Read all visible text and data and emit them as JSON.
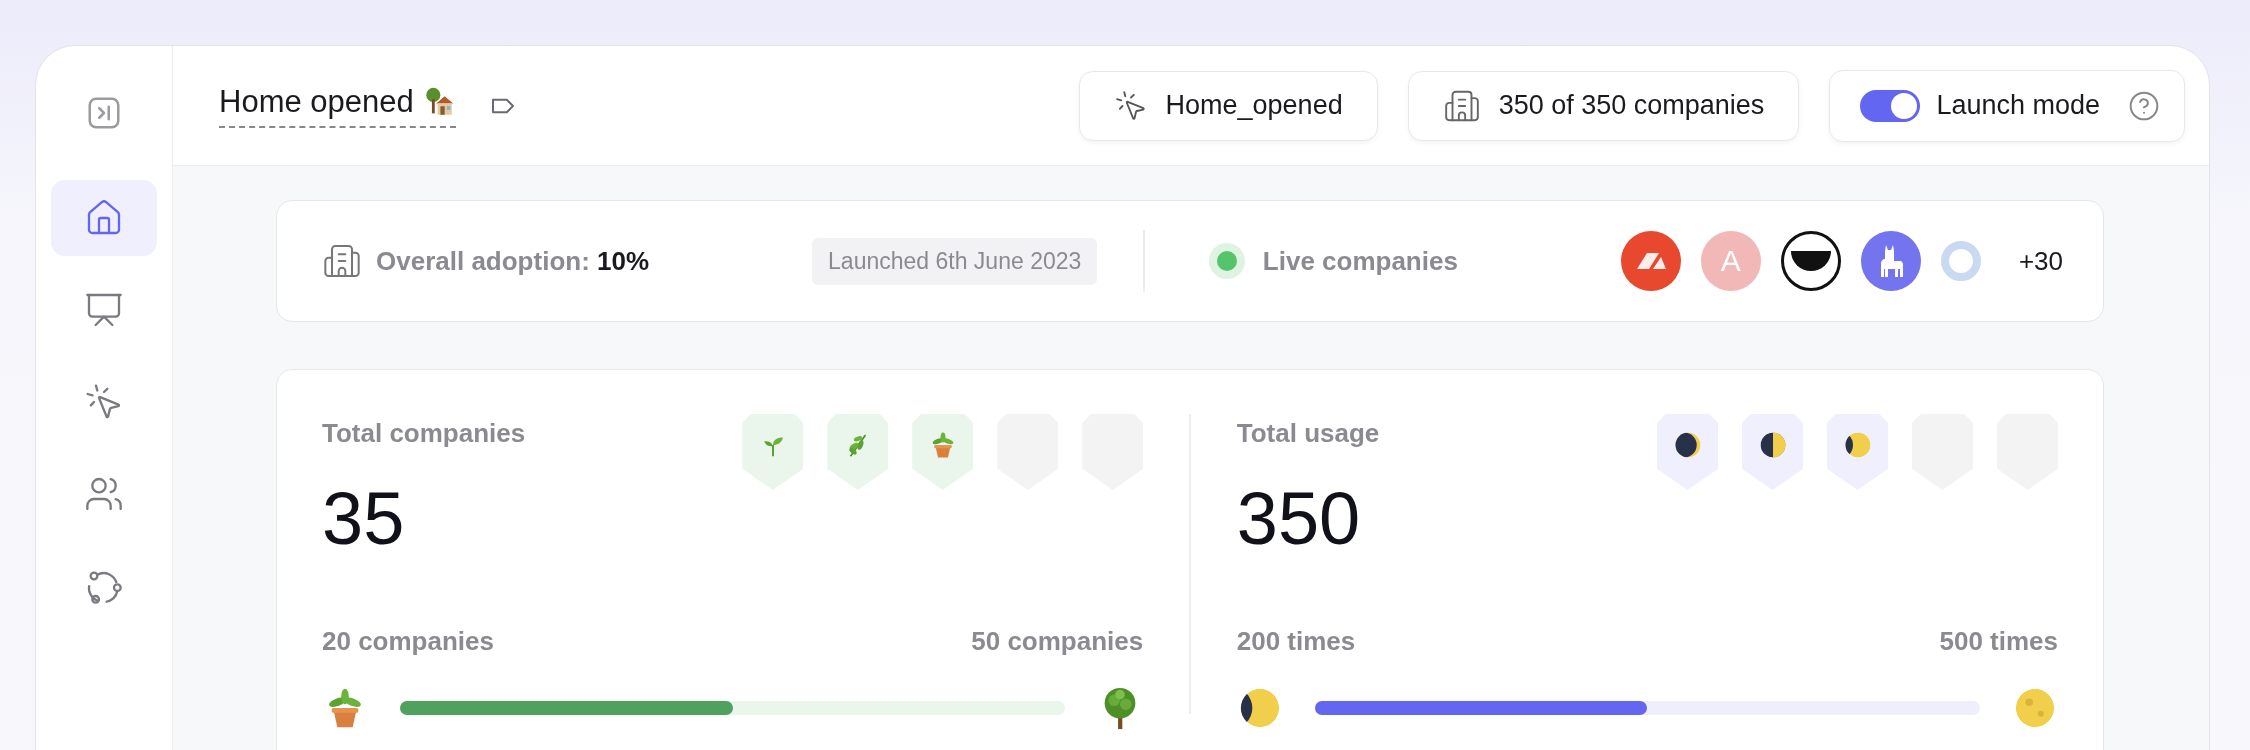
{
  "sidebar": {
    "items": [
      {
        "kind": "home",
        "selected": true
      },
      {
        "kind": "presentation",
        "selected": false
      },
      {
        "kind": "cursor",
        "selected": false
      },
      {
        "kind": "users",
        "selected": false
      },
      {
        "kind": "workflow",
        "selected": false
      }
    ]
  },
  "header": {
    "title": "Home opened",
    "event_button": "Home_opened",
    "companies_button": "350 of 350 companies",
    "launch_mode": {
      "label": "Launch mode",
      "on": true
    }
  },
  "adoption": {
    "label": "Overall adoption:",
    "value": "10%",
    "launched": "Launched 6th June 2023",
    "live_label": "Live companies",
    "avatars": [
      {
        "kind": "logo",
        "color": "#e8482e"
      },
      {
        "kind": "letter",
        "text": "A",
        "color": "#f2b8b8"
      },
      {
        "kind": "half-circle",
        "color": "#111111"
      },
      {
        "kind": "llama",
        "color": "#7474ee"
      },
      {
        "kind": "ring",
        "color": "#c9d9f2"
      }
    ],
    "more": "+30"
  },
  "stats": [
    {
      "kind": "companies",
      "label": "Total companies",
      "value": "35",
      "min_label": "20 companies",
      "max_label": "50 companies",
      "level": 0.5,
      "start_marker": {
        "kind": "potted-plant"
      },
      "end_marker": {
        "kind": "tree"
      },
      "badges": [
        {
          "kind": "sprout"
        },
        {
          "kind": "herb"
        },
        {
          "kind": "potted-plant"
        },
        {
          "kind": "empty"
        },
        {
          "kind": "empty"
        }
      ]
    },
    {
      "kind": "usage",
      "label": "Total usage",
      "value": "350",
      "min_label": "200 times",
      "max_label": "500 times",
      "level": 0.5,
      "start_marker": {
        "kind": "waxing-gibbous"
      },
      "end_marker": {
        "kind": "full-moon"
      },
      "badges": [
        {
          "kind": "waxing-crescent"
        },
        {
          "kind": "first-quarter"
        },
        {
          "kind": "waxing-gibbous"
        },
        {
          "kind": "empty"
        },
        {
          "kind": "empty"
        }
      ]
    }
  ]
}
